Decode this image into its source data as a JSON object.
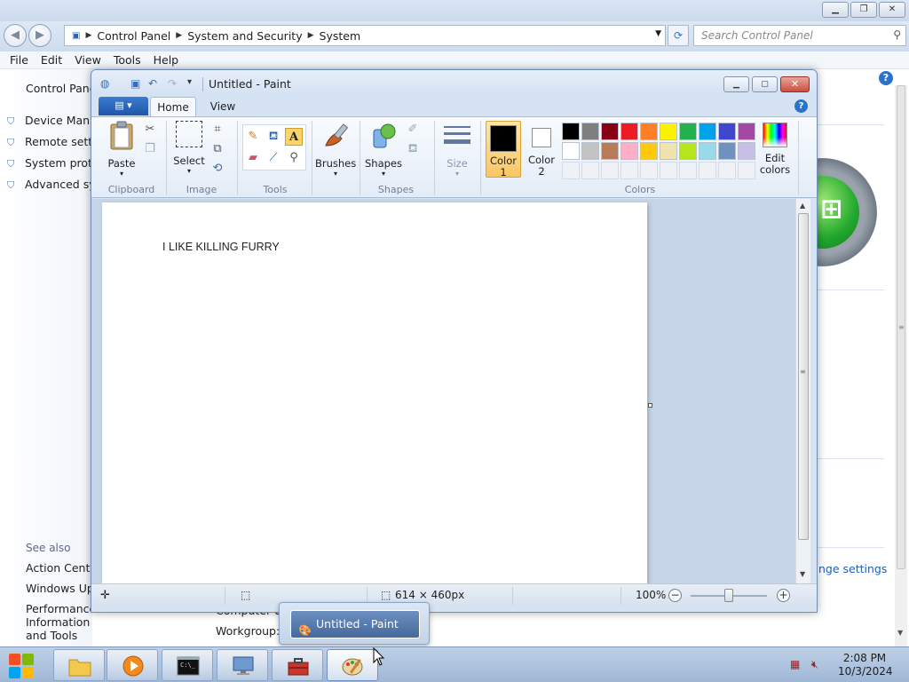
{
  "control_panel": {
    "breadcrumb": [
      "Control Panel",
      "System and Security",
      "System"
    ],
    "search_placeholder": "Search Control Panel",
    "menu": [
      "File",
      "Edit",
      "View",
      "Tools",
      "Help"
    ],
    "home": "Control Panel",
    "tasks": [
      "Device Manager",
      "Remote settings",
      "System protection",
      "Advanced system settings"
    ],
    "see_also": "See also",
    "see_also_links": [
      "Action Center",
      "Windows Update",
      "Performance Information and Tools"
    ],
    "change_settings": "nge settings",
    "behind_labels": [
      "Computer de",
      "Workgroup:"
    ]
  },
  "paint": {
    "title": "Untitled - Paint",
    "file_tab": "▤ ▾",
    "tabs": [
      "Home",
      "View"
    ],
    "groups": {
      "clipboard": {
        "label": "Clipboard",
        "paste": "Paste"
      },
      "image": {
        "label": "Image",
        "select": "Select"
      },
      "tools": {
        "label": "Tools"
      },
      "brushes": {
        "label": "Brushes"
      },
      "shapes": {
        "label": "Shapes",
        "shapes_btn": "Shapes"
      },
      "size": {
        "label": "Size"
      },
      "colors": {
        "label": "Colors",
        "color1_line1": "Color",
        "color1_line2": "1",
        "color2_line1": "Color",
        "color2_line2": "2",
        "edit_line1": "Edit",
        "edit_line2": "colors",
        "color1_value": "#000000",
        "color2_value": "#ffffff",
        "palette_row1": [
          "#000000",
          "#7f7f7f",
          "#880015",
          "#ed1c24",
          "#ff7f27",
          "#fff200",
          "#22b14c",
          "#00a2e8",
          "#3f48cc",
          "#a349a4"
        ],
        "palette_row2": [
          "#ffffff",
          "#c3c3c3",
          "#b97a57",
          "#ffaec9",
          "#ffc90e",
          "#efe4b0",
          "#b5e61d",
          "#99d9ea",
          "#7092be",
          "#c8bfe7"
        ]
      }
    },
    "canvas_text": "I LIKE KILLING FURRY",
    "status": {
      "dimensions": "614 × 460px",
      "zoom": "100%"
    }
  },
  "taskbar": {
    "preview_title": "Untitled - Paint",
    "clock_time": "2:08 PM",
    "clock_date": "10/3/2024"
  }
}
